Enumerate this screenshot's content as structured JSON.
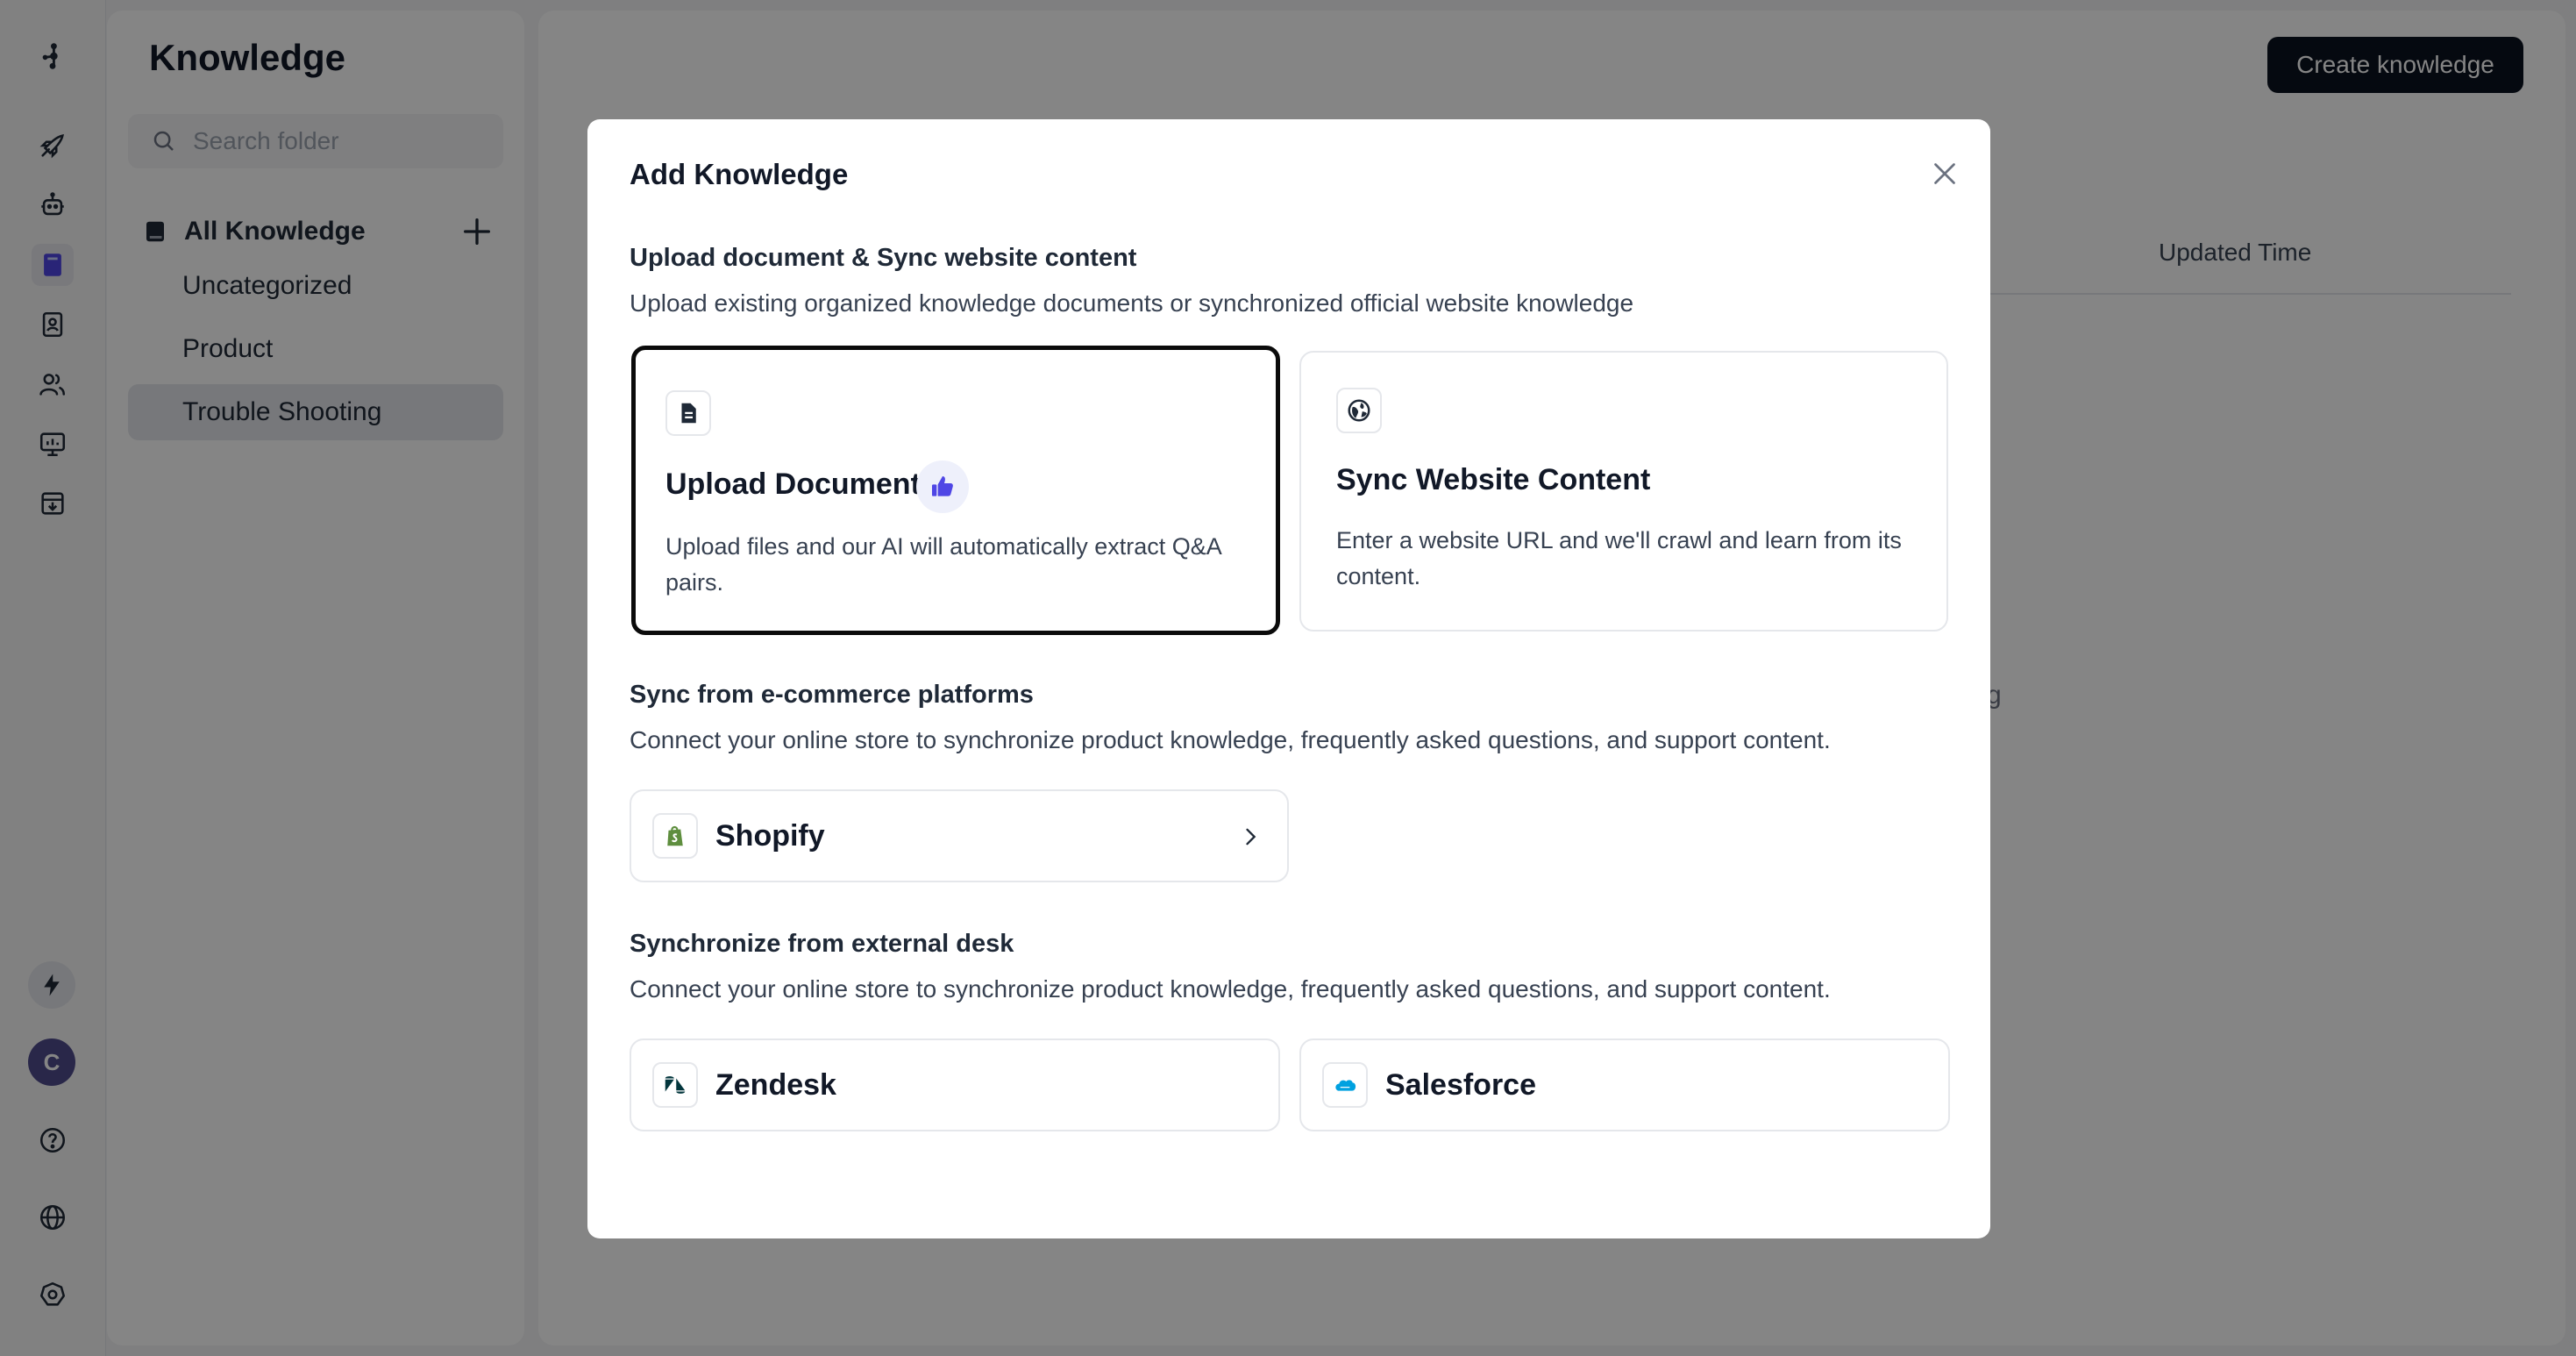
{
  "sidebar": {
    "title": "Knowledge",
    "search_placeholder": "Search folder",
    "all_knowledge_label": "All Knowledge",
    "folders": [
      {
        "label": "Uncategorized"
      },
      {
        "label": "Product"
      },
      {
        "label": "Trouble Shooting"
      }
    ]
  },
  "rail": {
    "icons": [
      "logo-icon",
      "rocket-icon",
      "bot-icon",
      "book-icon",
      "contacts-icon",
      "users-icon",
      "analytics-icon",
      "inbox-icon",
      "bolt-icon",
      "help-icon",
      "globe-icon",
      "settings-icon"
    ],
    "avatar_initial": "C",
    "accent": "#4f46e5"
  },
  "main": {
    "create_button": "Create knowledge",
    "column_updated_time": "Updated Time",
    "background_text": "ding"
  },
  "modal": {
    "title": "Add Knowledge",
    "section_upload": {
      "title": "Upload document & Sync website content",
      "desc": "Upload existing organized knowledge documents or synchronized official website knowledge"
    },
    "upload_card": {
      "title": "Upload Document",
      "desc": "Upload files and our AI will automatically extract Q&A pairs."
    },
    "sync_card": {
      "title": "Sync Website Content",
      "desc": "Enter a website URL and we'll crawl and learn from its content."
    },
    "section_ecommerce": {
      "title": "Sync from e-commerce platforms",
      "desc": "Connect your online store to synchronize product knowledge, frequently asked questions, and support content."
    },
    "shopify_label": "Shopify",
    "section_desk": {
      "title": "Synchronize from external desk",
      "desc": "Connect your online store to synchronize product knowledge, frequently asked questions, and support content."
    },
    "zendesk_label": "Zendesk",
    "salesforce_label": "Salesforce"
  },
  "colors": {
    "primary_button": "#0b1220",
    "selected_card_border": "#0b0b0b",
    "thumb_accent": "#4f46e5",
    "shopify_green": "#5e8e3e",
    "salesforce_blue": "#00a1e0"
  }
}
